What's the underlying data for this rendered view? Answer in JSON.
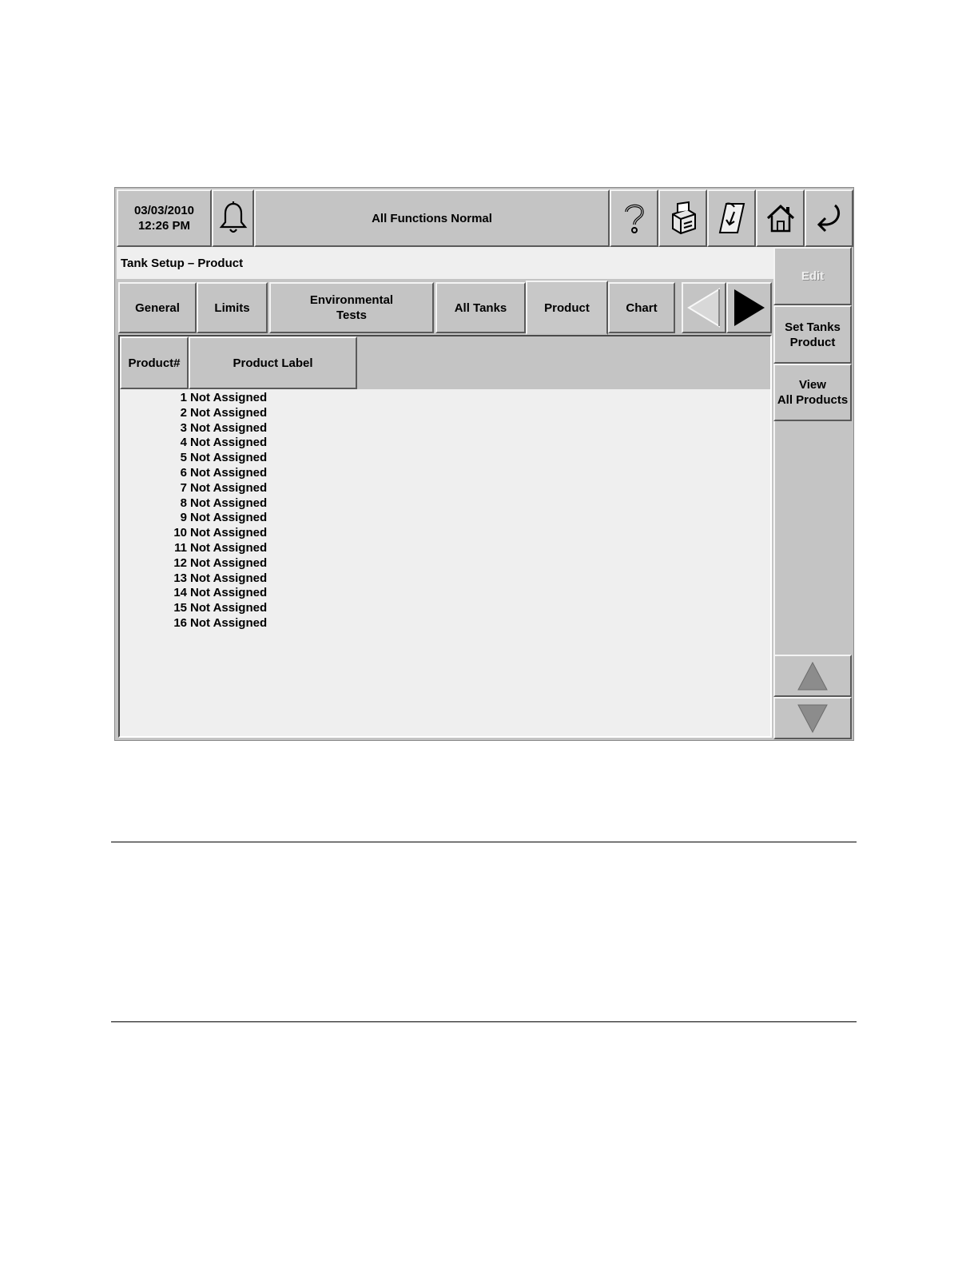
{
  "header": {
    "date": "03/03/2010",
    "time": "12:26 PM",
    "status": "All Functions Normal",
    "icons": [
      "bell-icon",
      "help-icon",
      "printer-icon",
      "report-icon",
      "home-icon",
      "back-icon"
    ]
  },
  "page_title": "Tank Setup – Product",
  "tabs": [
    {
      "label": "General"
    },
    {
      "label": "Limits"
    },
    {
      "label": "Environmental\nTests"
    },
    {
      "label": "All Tanks"
    },
    {
      "label": "Product",
      "active": true
    },
    {
      "label": "Chart"
    }
  ],
  "table": {
    "columns": [
      "Product#",
      "Product Label"
    ],
    "rows": [
      {
        "num": "1",
        "label": "Not Assigned"
      },
      {
        "num": "2",
        "label": "Not Assigned"
      },
      {
        "num": "3",
        "label": "Not Assigned"
      },
      {
        "num": "4",
        "label": "Not Assigned"
      },
      {
        "num": "5",
        "label": "Not Assigned"
      },
      {
        "num": "6",
        "label": "Not Assigned"
      },
      {
        "num": "7",
        "label": "Not Assigned"
      },
      {
        "num": "8",
        "label": "Not Assigned"
      },
      {
        "num": "9",
        "label": "Not Assigned"
      },
      {
        "num": "10",
        "label": "Not Assigned"
      },
      {
        "num": "11",
        "label": "Not Assigned"
      },
      {
        "num": "12",
        "label": "Not Assigned"
      },
      {
        "num": "13",
        "label": "Not Assigned"
      },
      {
        "num": "14",
        "label": "Not Assigned"
      },
      {
        "num": "15",
        "label": "Not Assigned"
      },
      {
        "num": "16",
        "label": "Not Assigned"
      }
    ]
  },
  "side_buttons": {
    "edit": "Edit",
    "set_tanks_product": "Set Tanks\nProduct",
    "view_all_products": "View\nAll Products"
  },
  "colors": {
    "panel_gray": "#c4c4c4",
    "content_bg": "#efefef"
  }
}
